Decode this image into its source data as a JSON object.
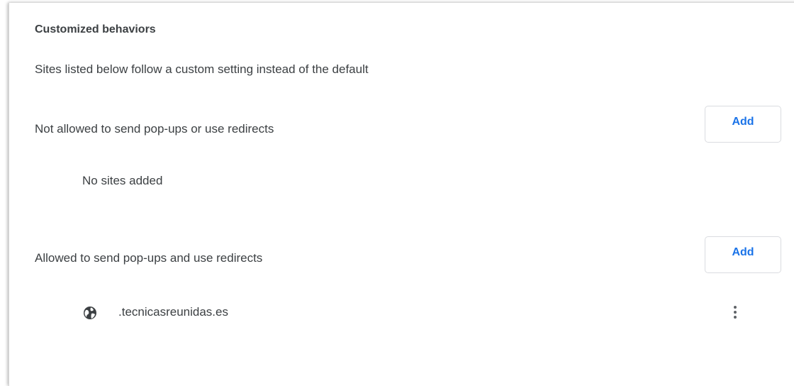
{
  "section": {
    "title": "Customized behaviors",
    "description": "Sites listed below follow a custom setting instead of the default"
  },
  "blocked": {
    "label": "Not allowed to send pop-ups or use redirects",
    "add_label": "Add",
    "empty_text": "No sites added"
  },
  "allowed": {
    "label": "Allowed to send pop-ups and use redirects",
    "add_label": "Add",
    "sites": [
      {
        "name": ".tecnicasreunidas.es",
        "icon": "globe-icon"
      }
    ]
  },
  "colors": {
    "accent": "#1a73e8",
    "text": "#3c4043",
    "border": "#dadce0",
    "icon": "#5f6368"
  }
}
